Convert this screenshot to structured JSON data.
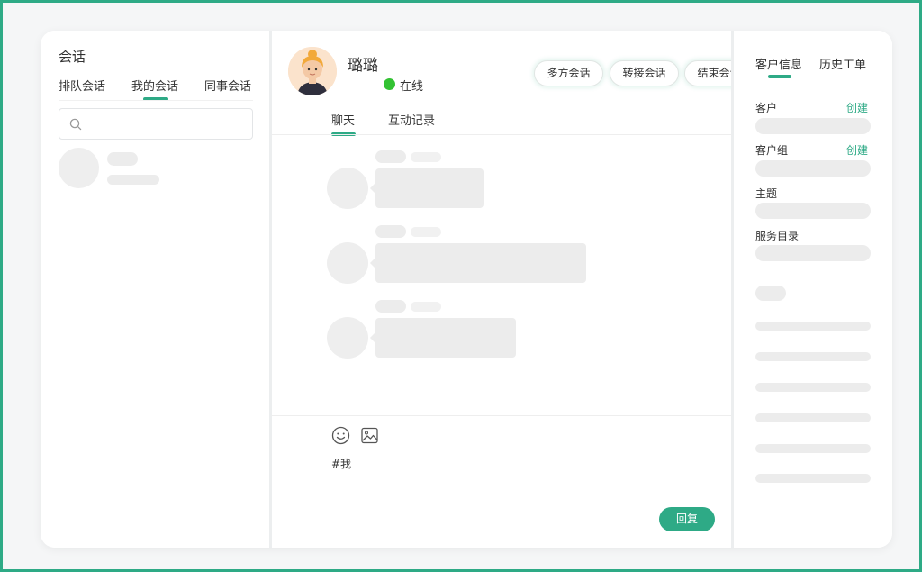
{
  "left_panel": {
    "title": "会话",
    "tabs": [
      {
        "label": "排队会话",
        "active": false
      },
      {
        "label": "我的会话",
        "active": true
      },
      {
        "label": "同事会话",
        "active": false
      }
    ],
    "search": {
      "placeholder": "",
      "icon": "search-icon"
    }
  },
  "chat": {
    "contact_name": "璐璐",
    "status": "在线",
    "actions": [
      "多方会话",
      "转接会话",
      "结束会话"
    ],
    "tabs": [
      {
        "label": "聊天",
        "active": true
      },
      {
        "label": "互动记录",
        "active": false
      }
    ],
    "composer": {
      "icons": [
        "emoji-icon",
        "image-icon"
      ],
      "text": "#我",
      "reply_label": "回复"
    }
  },
  "right_panel": {
    "tabs": [
      {
        "label": "客户信息",
        "active": true
      },
      {
        "label": "历史工单",
        "active": false
      }
    ],
    "fields": [
      {
        "label": "客户",
        "action": "创建"
      },
      {
        "label": "客户组",
        "action": "创建"
      },
      {
        "label": "主题",
        "action": ""
      },
      {
        "label": "服务目录",
        "action": ""
      }
    ]
  },
  "colors": {
    "accent": "#2eaa86",
    "online": "#33c233",
    "skeleton": "#ececec"
  }
}
